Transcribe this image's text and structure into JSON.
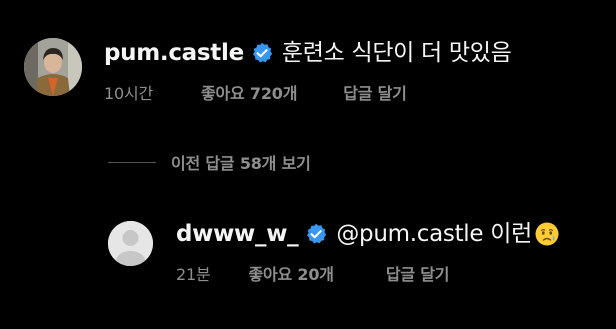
{
  "comment": {
    "username": "pum.castle",
    "text": "훈련소 식단이 더 맛있음",
    "time": "10시간",
    "likes": "좋아요 720개",
    "reply": "답글 달기",
    "verified_icon": "verified-badge-icon"
  },
  "view_replies": {
    "label": "이전 답글 58개 보기"
  },
  "reply_comment": {
    "username": "dwww_w_",
    "text": "@pum.castle 이런",
    "time": "21분",
    "likes": "좋아요 20개",
    "reply": "답글 달기",
    "verified_icon": "verified-badge-icon",
    "emoji_icon": "crying-face-icon"
  },
  "colors": {
    "background": "#000000",
    "primary_text": "#f5f5f5",
    "secondary_text": "#8e8e8e",
    "verified_blue": "#3897f0"
  }
}
